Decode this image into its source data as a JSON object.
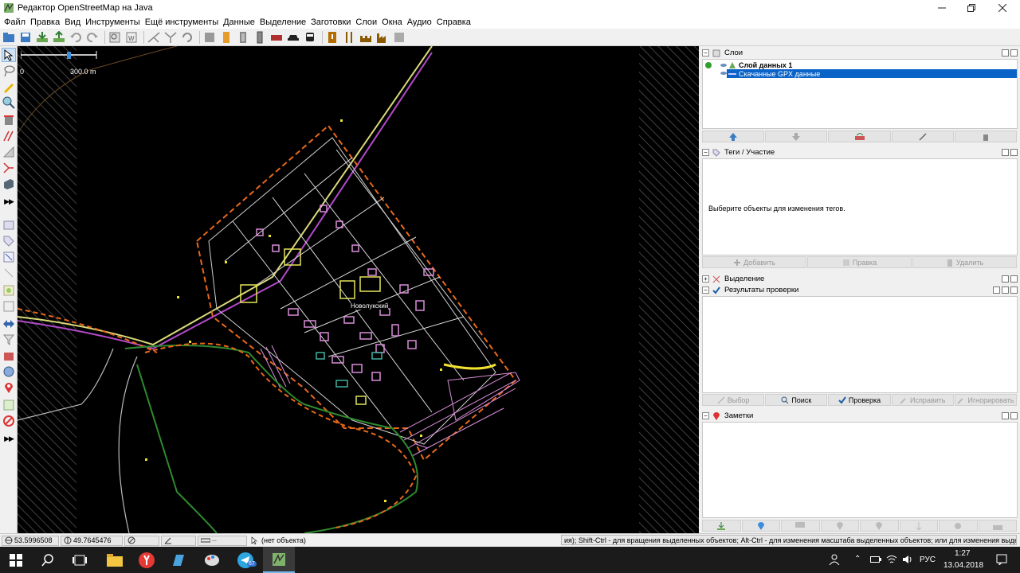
{
  "window": {
    "title": "Редактор OpenStreetMap на Java",
    "controls": [
      "minimize",
      "maximize",
      "close"
    ]
  },
  "menu": [
    "Файл",
    "Правка",
    "Вид",
    "Инструменты",
    "Ещё инструменты",
    "Данные",
    "Выделение",
    "Заготовки",
    "Слои",
    "Окна",
    "Аудио",
    "Справка"
  ],
  "map": {
    "scale_start": "0",
    "scale_end": "300.0 m",
    "place_label": "Новолукский"
  },
  "panels": {
    "layers": {
      "title": "Слои",
      "items": [
        {
          "name": "Слой данных 1",
          "active": true
        },
        {
          "name": "Скачанные GPX данные",
          "selected": true
        }
      ]
    },
    "tags": {
      "title": "Теги / Участие",
      "empty_message": "Выберите объекты для изменения тегов.",
      "buttons": [
        "Добавить",
        "Правка",
        "Удалить"
      ]
    },
    "selection": {
      "title": "Выделение"
    },
    "validation": {
      "title": "Результаты проверки",
      "buttons": [
        "Выбор",
        "Поиск",
        "Проверка",
        "Исправить",
        "Игнорировать"
      ]
    },
    "notes": {
      "title": "Заметки"
    }
  },
  "status": {
    "lat": "53.5996508",
    "lon": "49.7645476",
    "object": "(нет объекта)",
    "help": "ия); Shift-Ctrl - для вращения выделенных объектов; Alt-Ctrl - для изменения масштаба выделенных объектов; или для изменения выделения"
  },
  "taskbar": {
    "language": "РУС",
    "time": "1:27",
    "date": "13.04.2018",
    "telegram_badge": "67"
  },
  "colors": {
    "map_bg": "#000000",
    "selection": "#0a64c8",
    "taskbar": "#1b1b1b"
  }
}
